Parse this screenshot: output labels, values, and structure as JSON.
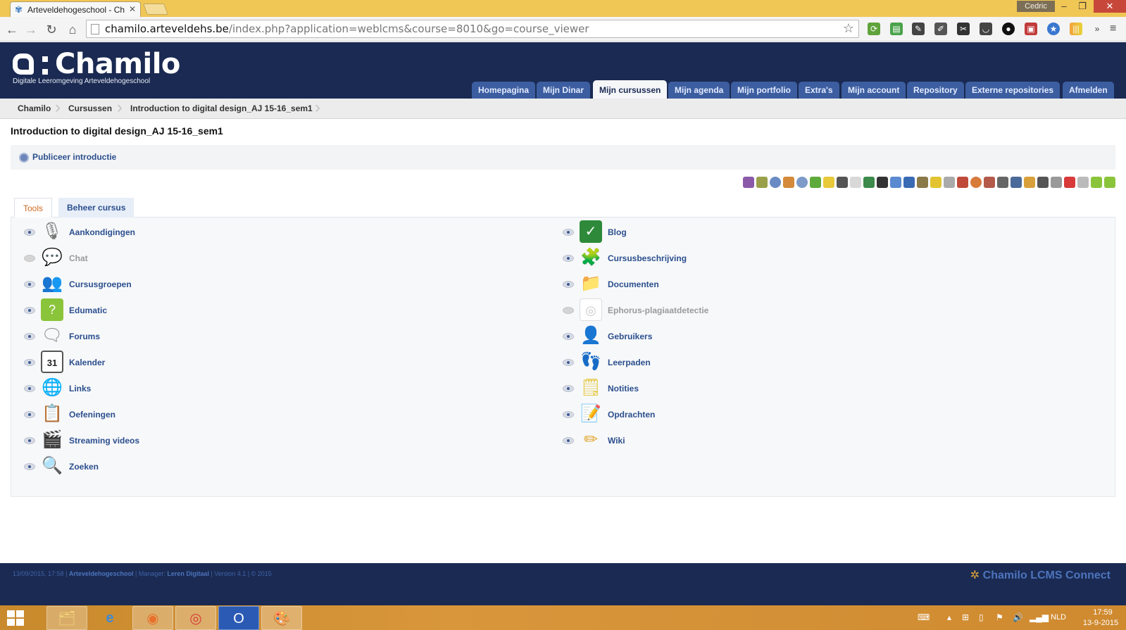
{
  "browser": {
    "tab_title": "Arteveldehogeschool - Ch",
    "user": "Cedric",
    "url_host": "chamilo.arteveldehs.be",
    "url_path": "/index.php?application=weblcms&course=8010&go=course_viewer",
    "window_controls": {
      "minimize": "–",
      "maximize": "❐",
      "close": "✕"
    }
  },
  "site": {
    "logo_text": "Chamilo",
    "logo_subtitle": "Digitale Leeromgeving Arteveldehogeschool",
    "nav": [
      {
        "label": "Homepagina"
      },
      {
        "label": "Mijn Dinar"
      },
      {
        "label": "Mijn cursussen",
        "active": true
      },
      {
        "label": "Mijn agenda"
      },
      {
        "label": "Mijn portfolio"
      },
      {
        "label": "Extra's"
      },
      {
        "label": "Mijn account"
      },
      {
        "label": "Repository"
      },
      {
        "label": "Externe repositories"
      },
      {
        "label": "Afmelden"
      }
    ]
  },
  "breadcrumb": [
    "Chamilo",
    "Cursussen",
    "Introduction to digital design_AJ 15-16_sem1"
  ],
  "course": {
    "title": "Introduction to digital design_AJ 15-16_sem1",
    "publish_intro": "Publiceer introductie",
    "tabs": {
      "tools": "Tools",
      "manage": "Beheer cursus"
    },
    "tools_left": [
      {
        "label": "Aankondigingen",
        "visible": true,
        "icon": "microphone-icon"
      },
      {
        "label": "Chat",
        "visible": false,
        "icon": "chat-icon"
      },
      {
        "label": "Cursusgroepen",
        "visible": true,
        "icon": "groups-icon"
      },
      {
        "label": "Edumatic",
        "visible": true,
        "icon": "edumatic-icon"
      },
      {
        "label": "Forums",
        "visible": true,
        "icon": "forum-icon"
      },
      {
        "label": "Kalender",
        "visible": true,
        "icon": "calendar-icon"
      },
      {
        "label": "Links",
        "visible": true,
        "icon": "globe-icon"
      },
      {
        "label": "Oefeningen",
        "visible": true,
        "icon": "clipboard-icon"
      },
      {
        "label": "Streaming videos",
        "visible": true,
        "icon": "clapperboard-icon"
      },
      {
        "label": "Zoeken",
        "visible": true,
        "icon": "magnifier-icon"
      }
    ],
    "tools_right": [
      {
        "label": "Blog",
        "visible": true,
        "icon": "blog-icon"
      },
      {
        "label": "Cursusbeschrijving",
        "visible": true,
        "icon": "puzzle-icon"
      },
      {
        "label": "Documenten",
        "visible": true,
        "icon": "folder-icon"
      },
      {
        "label": "Ephorus-plagiaatdetectie",
        "visible": false,
        "icon": "ephorus-icon"
      },
      {
        "label": "Gebruikers",
        "visible": true,
        "icon": "user-icon"
      },
      {
        "label": "Leerpaden",
        "visible": true,
        "icon": "footprints-icon"
      },
      {
        "label": "Notities",
        "visible": true,
        "icon": "notes-icon"
      },
      {
        "label": "Opdrachten",
        "visible": true,
        "icon": "assignment-icon"
      },
      {
        "label": "Wiki",
        "visible": true,
        "icon": "wiki-pencil-icon"
      }
    ]
  },
  "footer": {
    "date": "13/09/2015, 17:58",
    "org": "Arteveldehogeschool",
    "manager_label": "Manager:",
    "manager": "Leren Digitaal",
    "version": "Version 4.1",
    "copyright": "© 2015",
    "brand": "Chamilo LCMS Connect"
  },
  "taskbar": {
    "lang": "NLD",
    "time": "17:59",
    "date": "13-9-2015"
  },
  "colors": {
    "header_bg": "#1a2a52",
    "nav_tab": "#3c5ea0",
    "link": "#2b4f8e",
    "active_tab_text": "#d06a1e",
    "chrome_title": "#f0c654"
  }
}
